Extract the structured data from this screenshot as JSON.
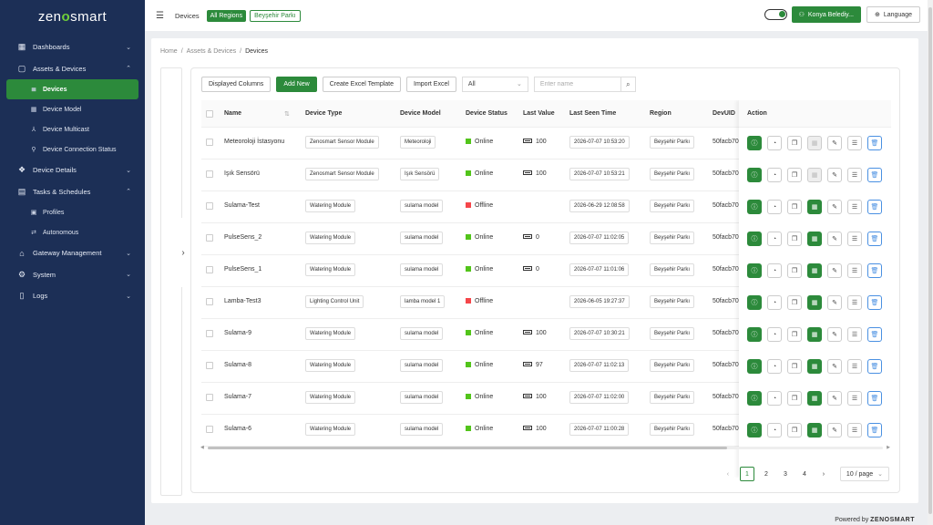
{
  "logo": {
    "left": "zen",
    "mark": "o",
    "right": "smart"
  },
  "sidebar": {
    "items": [
      {
        "label": "Dashboards",
        "icon": "dashboard-icon",
        "chevron": "⌄"
      },
      {
        "label": "Assets & Devices",
        "icon": "device-icon",
        "chevron": "⌃"
      },
      {
        "label": "Devices",
        "icon": "list-icon",
        "sub": true,
        "active": true
      },
      {
        "label": "Device Model",
        "icon": "grid-icon",
        "sub": true
      },
      {
        "label": "Device Multicast",
        "icon": "multicast-icon",
        "sub": true
      },
      {
        "label": "Device Connection Status",
        "icon": "connection-icon",
        "sub": true
      },
      {
        "label": "Device Details",
        "icon": "details-icon",
        "chevron": "⌄"
      },
      {
        "label": "Tasks & Schedules",
        "icon": "calendar-icon",
        "chevron": "⌃"
      },
      {
        "label": "Profiles",
        "icon": "profile-icon",
        "sub": true
      },
      {
        "label": "Autonomous",
        "icon": "auto-icon",
        "sub": true
      },
      {
        "label": "Gateway Management",
        "icon": "gateway-icon",
        "chevron": "⌄"
      },
      {
        "label": "System",
        "icon": "gear-icon",
        "chevron": "⌄"
      },
      {
        "label": "Logs",
        "icon": "file-icon",
        "chevron": "⌄"
      }
    ]
  },
  "topbar": {
    "title": "Devices",
    "chip_all": "All Regions",
    "chip_region": "Beyşehir Parkı",
    "user": "Konya Belediy...",
    "language": "Language"
  },
  "breadcrumb": {
    "home": "Home",
    "section": "Assets & Devices",
    "current": "Devices",
    "sep": "/"
  },
  "toolbar": {
    "displayed_columns": "Displayed Columns",
    "add_new": "Add New",
    "create_template": "Create Excel Template",
    "import_excel": "Import Excel",
    "filter_value": "All",
    "search_placeholder": "Enter name"
  },
  "table": {
    "headers": {
      "name": "Name",
      "type": "Device Type",
      "model": "Device Model",
      "status": "Device Status",
      "value": "Last Value",
      "seen": "Last Seen Time",
      "region": "Region",
      "uid": "DevUID",
      "action": "Action"
    },
    "rows": [
      {
        "name": "Meteoroloji İstasyonu",
        "type": "Zenosmart Sensor Module",
        "model": "Meteoroloji",
        "status": "Online",
        "value": "100",
        "seen": "2026-07-07 10:53:20",
        "region": "Beyşehir Parkı",
        "uid": "50facb70",
        "online": true,
        "battery": true,
        "disabled": true
      },
      {
        "name": "Işık Sensörü",
        "type": "Zenosmart Sensor Module",
        "model": "Işık Sensörü",
        "status": "Online",
        "value": "100",
        "seen": "2026-07-07 10:53:21",
        "region": "Beyşehir Parkı",
        "uid": "50facb70",
        "online": true,
        "battery": true,
        "disabled": true
      },
      {
        "name": "Sulama-Test",
        "type": "Watering Module",
        "model": "sulama model",
        "status": "Offline",
        "value": "",
        "seen": "2026-06-29 12:08:58",
        "region": "Beyşehir Parkı",
        "uid": "50facb70",
        "online": false,
        "battery": false,
        "disabled": false
      },
      {
        "name": "PulseSens_2",
        "type": "Watering Module",
        "model": "sulama model",
        "status": "Online",
        "value": "0",
        "seen": "2026-07-07 11:02:05",
        "region": "Beyşehir Parkı",
        "uid": "50facb70",
        "online": true,
        "battery": true,
        "disabled": false
      },
      {
        "name": "PulseSens_1",
        "type": "Watering Module",
        "model": "sulama model",
        "status": "Online",
        "value": "0",
        "seen": "2026-07-07 11:01:06",
        "region": "Beyşehir Parkı",
        "uid": "50facb70",
        "online": true,
        "battery": true,
        "disabled": false
      },
      {
        "name": "Lamba-Test3",
        "type": "Lighting Control Unit",
        "model": "lamba model 1",
        "status": "Offline",
        "value": "",
        "seen": "2026-06-05 19:27:37",
        "region": "Beyşehir Parkı",
        "uid": "50facb70",
        "online": false,
        "battery": false,
        "disabled": false
      },
      {
        "name": "Sulama-9",
        "type": "Watering Module",
        "model": "sulama model",
        "status": "Online",
        "value": "100",
        "seen": "2026-07-07 10:30:21",
        "region": "Beyşehir Parkı",
        "uid": "50facb70",
        "online": true,
        "battery": true,
        "disabled": false
      },
      {
        "name": "Sulama-8",
        "type": "Watering Module",
        "model": "sulama model",
        "status": "Online",
        "value": "97",
        "seen": "2026-07-07 11:02:13",
        "region": "Beyşehir Parkı",
        "uid": "50facb70",
        "online": true,
        "battery": true,
        "disabled": false
      },
      {
        "name": "Sulama-7",
        "type": "Watering Module",
        "model": "sulama model",
        "status": "Online",
        "value": "100",
        "seen": "2026-07-07 11:02:00",
        "region": "Beyşehir Parkı",
        "uid": "50facb70",
        "online": true,
        "battery": true,
        "disabled": false
      },
      {
        "name": "Sulama-6",
        "type": "Watering Module",
        "model": "sulama model",
        "status": "Online",
        "value": "100",
        "seen": "2026-07-07 11:00:28",
        "region": "Beyşehir Parkı",
        "uid": "50facb70",
        "online": true,
        "battery": true,
        "disabled": false
      }
    ]
  },
  "pagination": {
    "pages": [
      "1",
      "2",
      "3",
      "4"
    ],
    "current": "1",
    "page_size": "10 / page"
  },
  "footer": {
    "prefix": "Powered by",
    "brand": "ZENOSMART"
  },
  "colors": {
    "sidebar": "#1c2f56",
    "accent": "#2c8a3b",
    "online": "#52c41a",
    "offline": "#f5464a"
  }
}
